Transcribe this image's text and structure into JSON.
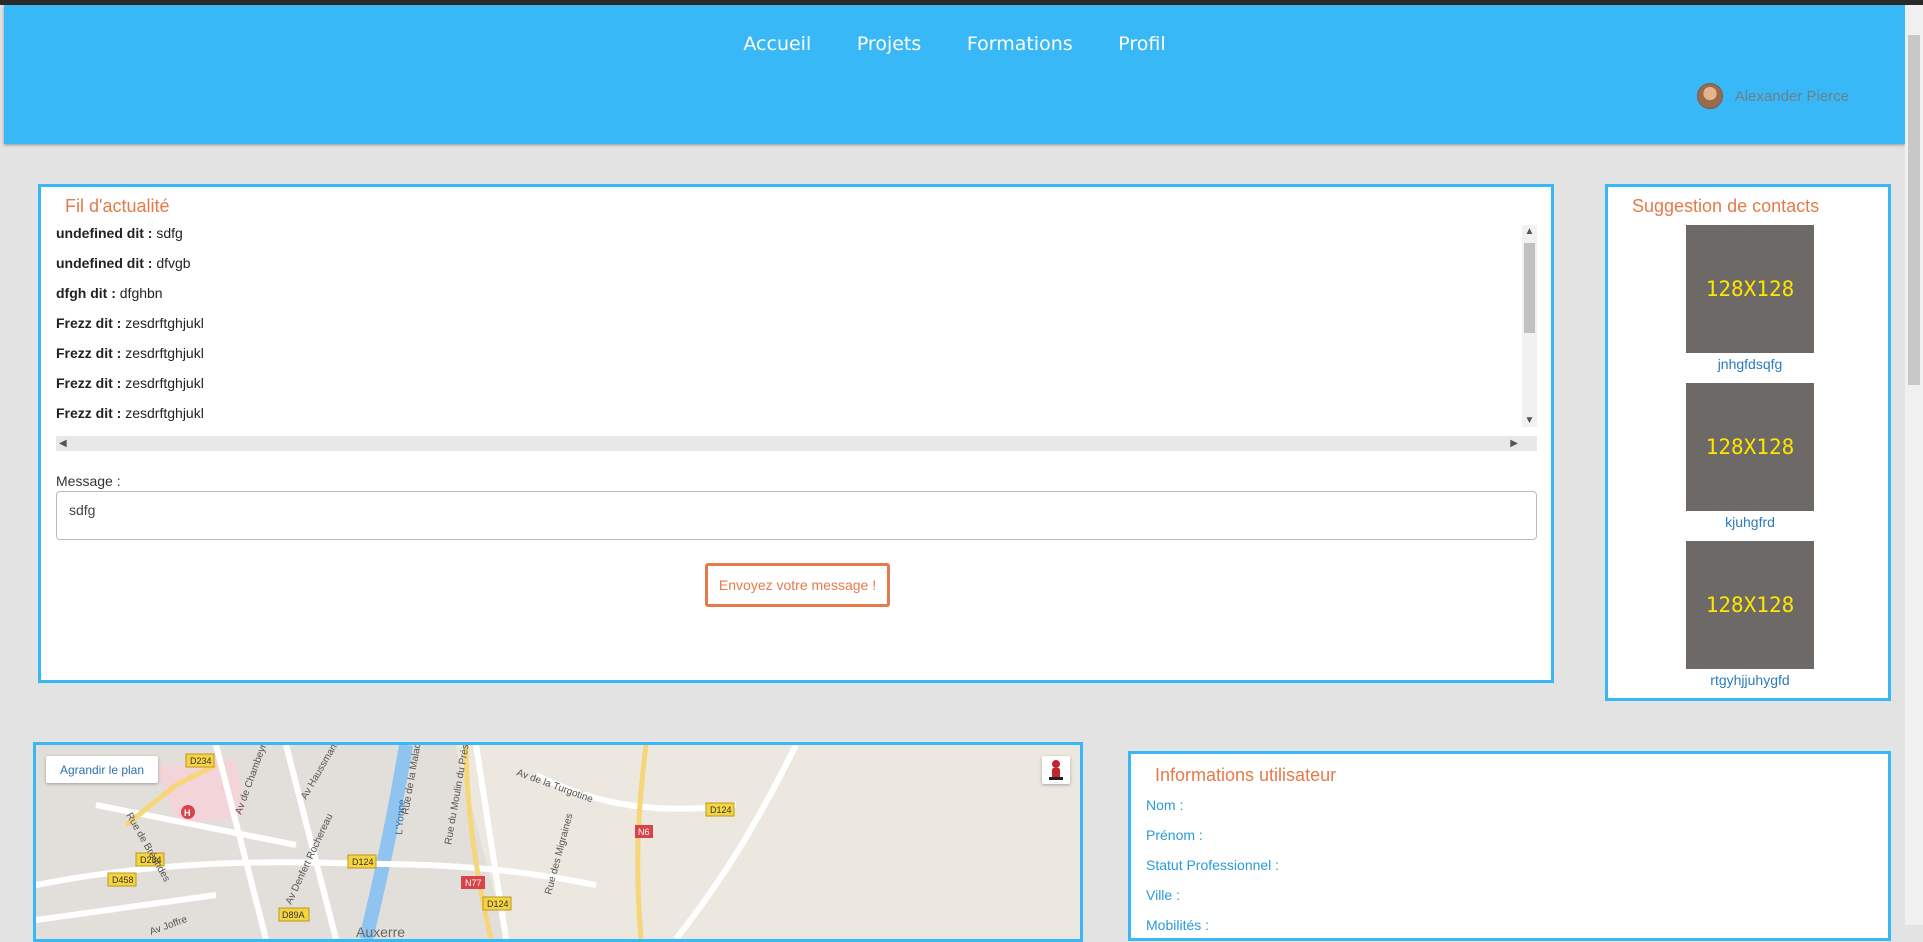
{
  "nav": {
    "items": [
      "Accueil",
      "Projets",
      "Formations",
      "Profil"
    ]
  },
  "user": {
    "name": "Alexander Pierce"
  },
  "feed": {
    "title": "Fil d'actualité",
    "items": [
      {
        "author": "undefined dit :",
        "text": "sdfg"
      },
      {
        "author": "undefined dit :",
        "text": "dfvgb"
      },
      {
        "author": "dfgh dit :",
        "text": "dfghbn"
      },
      {
        "author": "Frezz dit :",
        "text": "zesdrftghjukl"
      },
      {
        "author": "Frezz dit :",
        "text": "zesdrftghjukl"
      },
      {
        "author": "Frezz dit :",
        "text": "zesdrftghjukl"
      },
      {
        "author": "Frezz dit :",
        "text": "zesdrftghjukl"
      }
    ],
    "message_label": "Message :",
    "message_value": "sdfg",
    "send_label": "Envoyez votre message !"
  },
  "suggestions": {
    "title": "Suggestion de contacts",
    "placeholder_text": "128X128",
    "contacts": [
      "jnhgfdsqfg",
      "kjuhgfrd",
      "rtgyhjjuhygfd"
    ]
  },
  "map": {
    "enlarge_label": "Agrandir le plan",
    "labels": [
      "D234",
      "D458",
      "D234",
      "D124",
      "N77",
      "D124",
      "D89A",
      "N6",
      "D124",
      "Av de Chambeyrou",
      "Av Haussmann",
      "Av Denfert Rochereau",
      "Rue de la Maladière",
      "Rue du Moulin du Président",
      "Av de la Turgotine",
      "Rue des Migraines",
      "Av Joffre",
      "Auxerre",
      "L'Yonne",
      "Rue de Bréandes"
    ]
  },
  "info": {
    "title": "Informations utilisateur",
    "fields": [
      "Nom :",
      "Prénom :",
      "Statut Professionnel :",
      "Ville :",
      "Mobilités :"
    ]
  },
  "colors": {
    "topbar": "#38b8f6",
    "accent": "#e57a4b",
    "panel_border": "#38b8f6",
    "link": "#2a7bbd"
  }
}
